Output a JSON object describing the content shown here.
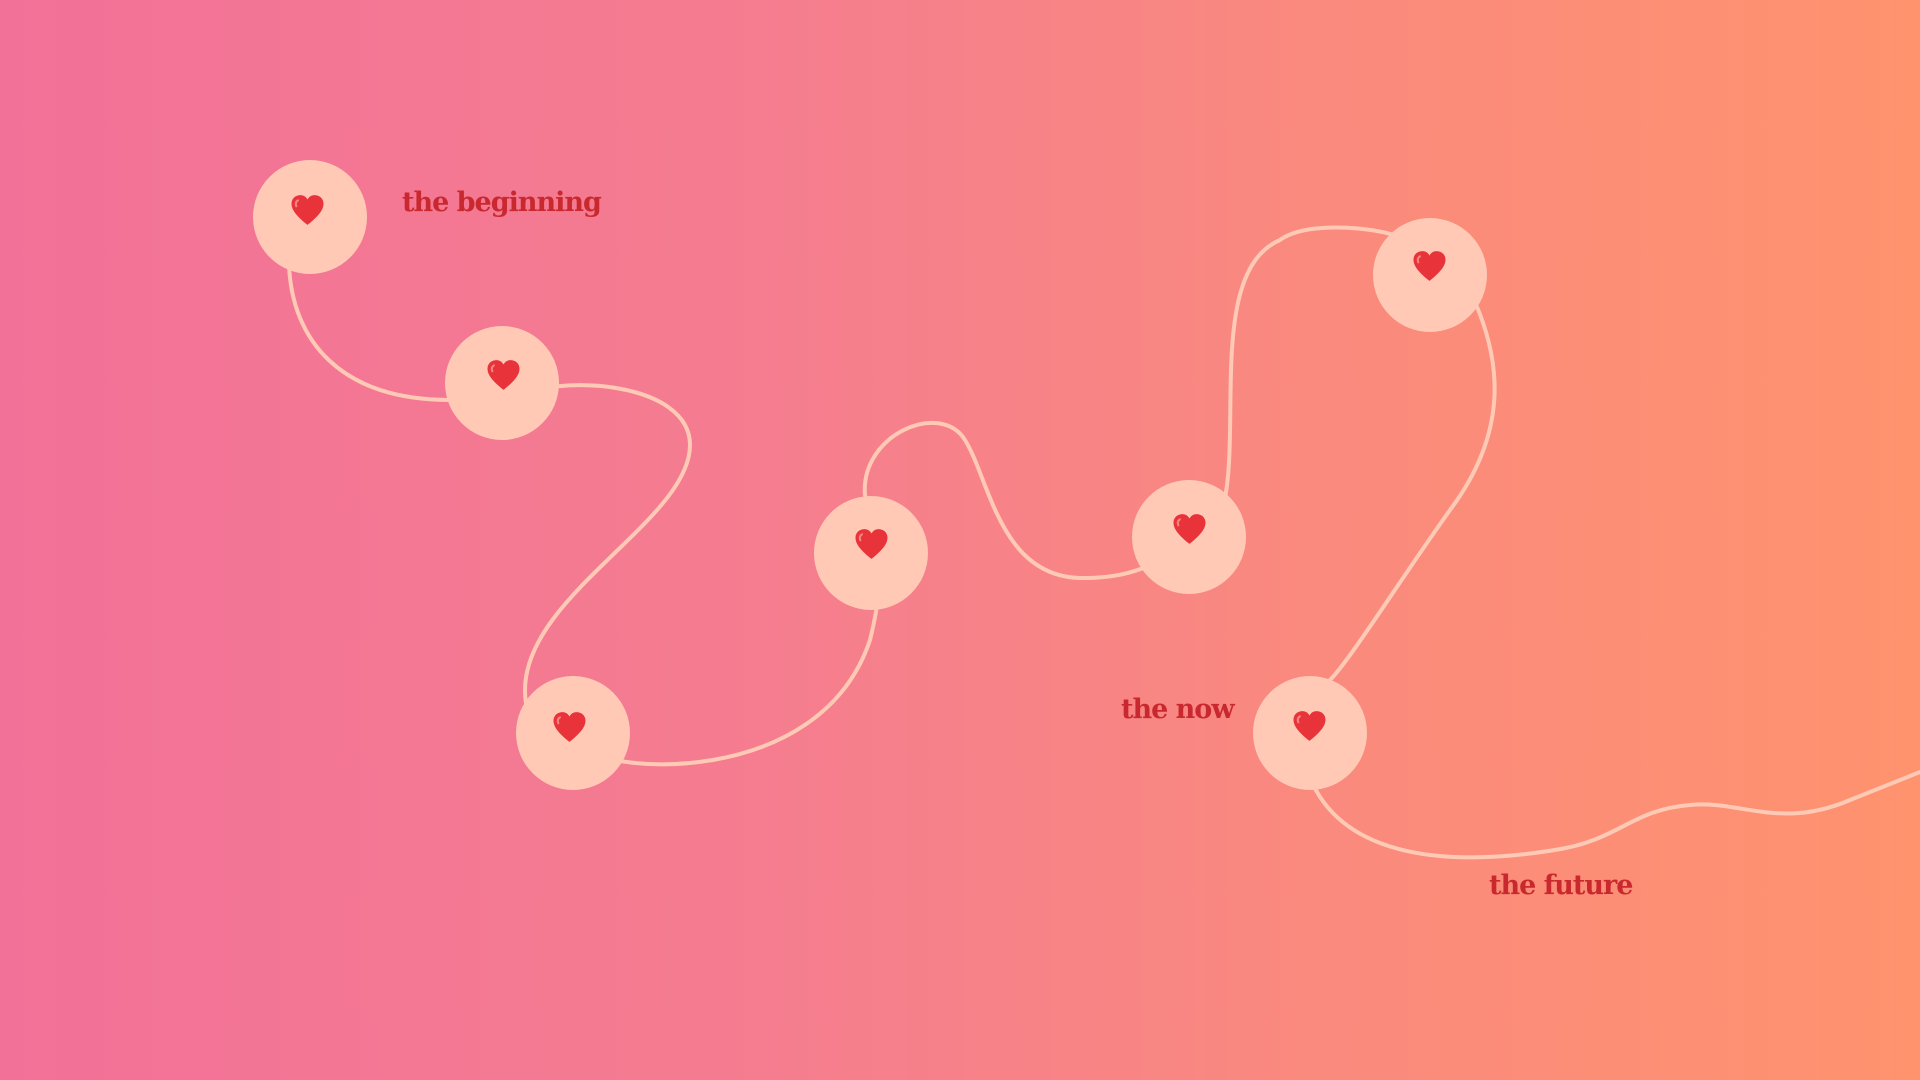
{
  "labels": {
    "beginning": "the beginning",
    "now": "the now",
    "future": "the future"
  },
  "nodes": [
    {
      "name": "timeline-node-1",
      "icon": "heart-icon"
    },
    {
      "name": "timeline-node-2",
      "icon": "heart-icon"
    },
    {
      "name": "timeline-node-3",
      "icon": "heart-icon"
    },
    {
      "name": "timeline-node-4",
      "icon": "heart-icon"
    },
    {
      "name": "timeline-node-5",
      "icon": "heart-icon"
    },
    {
      "name": "timeline-node-6",
      "icon": "heart-icon"
    },
    {
      "name": "timeline-node-7",
      "icon": "heart-icon"
    }
  ],
  "colors": {
    "gradient_start": "#f27198",
    "gradient_end": "#ff936e",
    "line": "#ffcab5",
    "node_fill": "#ffc9b5",
    "heart": "#e8333a",
    "label_text": "#c9292e"
  }
}
